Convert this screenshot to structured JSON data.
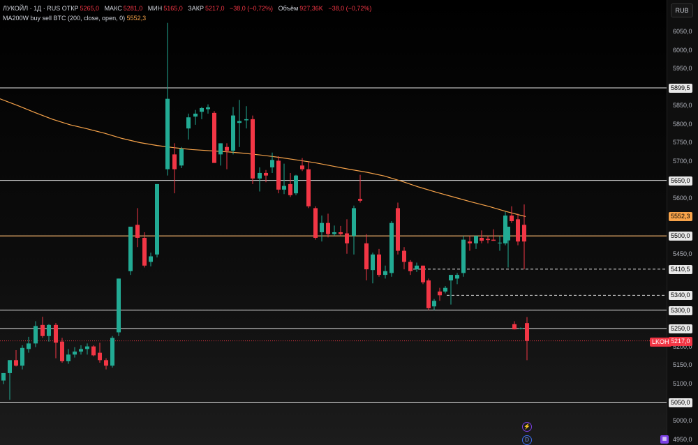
{
  "legend": {
    "title": "ЛУКОЙЛ · 1Д · RUS",
    "open_label": "ОТКР",
    "open_value": "5265,0",
    "high_label": "МАКС",
    "high_value": "5281,0",
    "low_label": "МИН",
    "low_value": "5165,0",
    "close_label": "ЗАКР",
    "close_value": "5217,0",
    "change_value": "−38,0 (−0,72%)",
    "volume_label": "Объём",
    "volume_value": "927,36K",
    "volume_change": "−38,0 (−0,72%)",
    "indicator": "MA200W buy sell BTC (200, close, open, 0)",
    "indicator_value": "5552,3"
  },
  "currency_button": "RUB",
  "ticker_tag": "LKOH",
  "price_axis": {
    "ticks": [
      "6050,0",
      "6000,0",
      "5950,0",
      "5850,0",
      "5800,0",
      "5750,0",
      "5700,0",
      "5600,0",
      "5450,0",
      "5250,0",
      "5200,0",
      "5150,0",
      "5100,0",
      "5000,0",
      "4950,0"
    ],
    "tick_values": [
      6050,
      6000,
      5950,
      5850,
      5800,
      5750,
      5700,
      5600,
      5450,
      5250,
      5200,
      5150,
      5100,
      5000,
      4950
    ]
  },
  "price_tags": [
    {
      "label": "5899,5",
      "value": 5899.5,
      "style": "white"
    },
    {
      "label": "5650,0",
      "value": 5650,
      "style": "white"
    },
    {
      "label": "5552,3",
      "value": 5552.3,
      "style": "orange"
    },
    {
      "label": "5500,0",
      "value": 5500,
      "style": "white"
    },
    {
      "label": "5410,5",
      "value": 5410.5,
      "style": "white"
    },
    {
      "label": "5340,0",
      "value": 5340,
      "style": "white"
    },
    {
      "label": "5300,0",
      "value": 5300,
      "style": "white"
    },
    {
      "label": "5250,0",
      "value": 5250,
      "style": "white"
    },
    {
      "label": "5217,0",
      "value": 5217,
      "style": "red"
    },
    {
      "label": "5050,0",
      "value": 5050,
      "style": "white"
    }
  ],
  "icons": {
    "lightning": "lightning-icon",
    "d_badge": "d-badge-icon",
    "logo": "tradingview-logo-icon"
  },
  "colors": {
    "up": "#22ab94",
    "down": "#f23645",
    "ma": "#f7a34a",
    "level": "#e8e8e8"
  },
  "chart_data": {
    "type": "candlestick",
    "title": "ЛУКОЙЛ · 1Д · RUS",
    "ylim": [
      4945,
      6075
    ],
    "grid": false,
    "horizontal_levels": [
      5899.5,
      5650,
      5500,
      5300,
      5250,
      5050
    ],
    "dashed_levels": [
      5410.5,
      5340
    ],
    "last_price": 5217,
    "ma_series": {
      "name": "MA200W buy sell BTC",
      "points": [
        [
          0,
          5870
        ],
        [
          25,
          5852
        ],
        [
          50,
          5833
        ],
        [
          75,
          5815
        ],
        [
          100,
          5800
        ],
        [
          125,
          5789
        ],
        [
          150,
          5777
        ],
        [
          175,
          5763
        ],
        [
          200,
          5752
        ],
        [
          225,
          5744
        ],
        [
          250,
          5738
        ],
        [
          275,
          5733
        ],
        [
          300,
          5730
        ],
        [
          325,
          5727
        ],
        [
          350,
          5723
        ],
        [
          375,
          5718
        ],
        [
          400,
          5712
        ],
        [
          425,
          5705
        ],
        [
          450,
          5698
        ],
        [
          475,
          5689
        ],
        [
          500,
          5680
        ],
        [
          525,
          5672
        ],
        [
          550,
          5662
        ],
        [
          575,
          5648
        ],
        [
          600,
          5632
        ],
        [
          625,
          5618
        ],
        [
          650,
          5605
        ],
        [
          675,
          5592
        ],
        [
          700,
          5580
        ],
        [
          725,
          5566
        ],
        [
          753,
          5552.3
        ]
      ]
    },
    "candles": [
      {
        "i": 0,
        "o": 5110,
        "h": 5125,
        "l": 5100,
        "c": 5130
      },
      {
        "i": 1,
        "o": 5130,
        "h": 5165,
        "l": 5058,
        "c": 5165
      },
      {
        "i": 2,
        "o": 5165,
        "h": 5192,
        "l": 5148,
        "c": 5150
      },
      {
        "i": 3,
        "o": 5150,
        "h": 5205,
        "l": 5140,
        "c": 5198
      },
      {
        "i": 4,
        "o": 5195,
        "h": 5228,
        "l": 5185,
        "c": 5210
      },
      {
        "i": 5,
        "o": 5210,
        "h": 5270,
        "l": 5200,
        "c": 5257
      },
      {
        "i": 6,
        "o": 5260,
        "h": 5282,
        "l": 5225,
        "c": 5230
      },
      {
        "i": 7,
        "o": 5230,
        "h": 5262,
        "l": 5215,
        "c": 5260
      },
      {
        "i": 8,
        "o": 5260,
        "h": 5265,
        "l": 5170,
        "c": 5212
      },
      {
        "i": 9,
        "o": 5215,
        "h": 5225,
        "l": 5158,
        "c": 5162
      },
      {
        "i": 10,
        "o": 5162,
        "h": 5195,
        "l": 5155,
        "c": 5180
      },
      {
        "i": 11,
        "o": 5180,
        "h": 5200,
        "l": 5172,
        "c": 5188
      },
      {
        "i": 12,
        "o": 5188,
        "h": 5205,
        "l": 5180,
        "c": 5195
      },
      {
        "i": 13,
        "o": 5195,
        "h": 5210,
        "l": 5180,
        "c": 5202
      },
      {
        "i": 14,
        "o": 5202,
        "h": 5205,
        "l": 5175,
        "c": 5178
      },
      {
        "i": 15,
        "o": 5185,
        "h": 5212,
        "l": 5158,
        "c": 5165
      },
      {
        "i": 16,
        "o": 5165,
        "h": 5170,
        "l": 5140,
        "c": 5150
      },
      {
        "i": 17,
        "o": 5150,
        "h": 5230,
        "l": 5145,
        "c": 5225
      },
      {
        "i": 18,
        "o": 5240,
        "h": 5385,
        "l": 5230,
        "c": 5385
      },
      {
        "i": 19,
        "o": 5405,
        "h": 5525,
        "l": 5395,
        "c": 5525
      },
      {
        "i": 20,
        "o": 5530,
        "h": 5575,
        "l": 5470,
        "c": 5495
      },
      {
        "i": 21,
        "o": 5495,
        "h": 5510,
        "l": 5415,
        "c": 5420
      },
      {
        "i": 22,
        "o": 5430,
        "h": 5455,
        "l": 5418,
        "c": 5445
      },
      {
        "i": 23,
        "o": 5450,
        "h": 5640,
        "l": 5442,
        "c": 5640
      },
      {
        "i": 24,
        "o": 5680,
        "h": 6075,
        "l": 5663,
        "c": 5870
      },
      {
        "i": 25,
        "o": 5720,
        "h": 5750,
        "l": 5615,
        "c": 5680
      },
      {
        "i": 26,
        "o": 5690,
        "h": 5740,
        "l": 5683,
        "c": 5735
      },
      {
        "i": 27,
        "o": 5790,
        "h": 5830,
        "l": 5760,
        "c": 5820
      },
      {
        "i": 28,
        "o": 5822,
        "h": 5840,
        "l": 5800,
        "c": 5830
      },
      {
        "i": 29,
        "o": 5835,
        "h": 5848,
        "l": 5815,
        "c": 5845
      },
      {
        "i": 30,
        "o": 5842,
        "h": 5855,
        "l": 5830,
        "c": 5847
      },
      {
        "i": 31,
        "o": 5832,
        "h": 5837,
        "l": 5697,
        "c": 5697
      },
      {
        "i": 32,
        "o": 5720,
        "h": 5750,
        "l": 5690,
        "c": 5750
      },
      {
        "i": 33,
        "o": 5740,
        "h": 5750,
        "l": 5680,
        "c": 5730
      },
      {
        "i": 34,
        "o": 5730,
        "h": 5848,
        "l": 5720,
        "c": 5825
      },
      {
        "i": 35,
        "o": 5805,
        "h": 5867,
        "l": 5740,
        "c": 5810
      },
      {
        "i": 36,
        "o": 5812,
        "h": 5850,
        "l": 5790,
        "c": 5815
      },
      {
        "i": 37,
        "o": 5815,
        "h": 5825,
        "l": 5640,
        "c": 5655
      },
      {
        "i": 38,
        "o": 5655,
        "h": 5685,
        "l": 5620,
        "c": 5670
      },
      {
        "i": 39,
        "o": 5670,
        "h": 5678,
        "l": 5645,
        "c": 5663
      },
      {
        "i": 40,
        "o": 5685,
        "h": 5725,
        "l": 5670,
        "c": 5705
      },
      {
        "i": 41,
        "o": 5703,
        "h": 5715,
        "l": 5615,
        "c": 5625
      },
      {
        "i": 42,
        "o": 5625,
        "h": 5695,
        "l": 5613,
        "c": 5635
      },
      {
        "i": 43,
        "o": 5640,
        "h": 5670,
        "l": 5605,
        "c": 5610
      },
      {
        "i": 44,
        "o": 5615,
        "h": 5665,
        "l": 5610,
        "c": 5663
      },
      {
        "i": 45,
        "o": 5690,
        "h": 5710,
        "l": 5675,
        "c": 5680
      },
      {
        "i": 46,
        "o": 5680,
        "h": 5700,
        "l": 5575,
        "c": 5580
      },
      {
        "i": 47,
        "o": 5575,
        "h": 5580,
        "l": 5490,
        "c": 5495
      },
      {
        "i": 48,
        "o": 5510,
        "h": 5555,
        "l": 5485,
        "c": 5535
      },
      {
        "i": 49,
        "o": 5535,
        "h": 5560,
        "l": 5496,
        "c": 5505
      },
      {
        "i": 50,
        "o": 5505,
        "h": 5528,
        "l": 5500,
        "c": 5510
      },
      {
        "i": 51,
        "o": 5510,
        "h": 5527,
        "l": 5500,
        "c": 5505
      },
      {
        "i": 52,
        "o": 5507,
        "h": 5545,
        "l": 5452,
        "c": 5480
      },
      {
        "i": 53,
        "o": 5500,
        "h": 5582,
        "l": 5450,
        "c": 5575
      },
      {
        "i": 54,
        "o": 5600,
        "h": 5665,
        "l": 5590,
        "c": 5595
      },
      {
        "i": 55,
        "o": 5480,
        "h": 5505,
        "l": 5380,
        "c": 5410
      },
      {
        "i": 56,
        "o": 5408,
        "h": 5455,
        "l": 5372,
        "c": 5450
      },
      {
        "i": 57,
        "o": 5450,
        "h": 5465,
        "l": 5390,
        "c": 5395
      },
      {
        "i": 58,
        "o": 5395,
        "h": 5420,
        "l": 5385,
        "c": 5405
      },
      {
        "i": 59,
        "o": 5400,
        "h": 5540,
        "l": 5390,
        "c": 5535
      },
      {
        "i": 60,
        "o": 5575,
        "h": 5590,
        "l": 5450,
        "c": 5460
      },
      {
        "i": 61,
        "o": 5460,
        "h": 5470,
        "l": 5410,
        "c": 5430
      },
      {
        "i": 62,
        "o": 5430,
        "h": 5435,
        "l": 5395,
        "c": 5405
      },
      {
        "i": 63,
        "o": 5410,
        "h": 5428,
        "l": 5403,
        "c": 5420
      },
      {
        "i": 64,
        "o": 5420,
        "h": 5410,
        "l": 5370,
        "c": 5375
      },
      {
        "i": 65,
        "o": 5380,
        "h": 5385,
        "l": 5300,
        "c": 5305
      },
      {
        "i": 66,
        "o": 5310,
        "h": 5330,
        "l": 5300,
        "c": 5325
      },
      {
        "i": 67,
        "o": 5350,
        "h": 5360,
        "l": 5325,
        "c": 5340
      },
      {
        "i": 68,
        "o": 5350,
        "h": 5365,
        "l": 5345,
        "c": 5360
      },
      {
        "i": 69,
        "o": 5380,
        "h": 5395,
        "l": 5315,
        "c": 5395
      },
      {
        "i": 70,
        "o": 5385,
        "h": 5400,
        "l": 5370,
        "c": 5395
      },
      {
        "i": 71,
        "o": 5400,
        "h": 5500,
        "l": 5390,
        "c": 5490
      },
      {
        "i": 72,
        "o": 5485,
        "h": 5500,
        "l": 5460,
        "c": 5480
      },
      {
        "i": 73,
        "o": 5480,
        "h": 5500,
        "l": 5465,
        "c": 5500
      },
      {
        "i": 74,
        "o": 5495,
        "h": 5515,
        "l": 5480,
        "c": 5487
      },
      {
        "i": 75,
        "o": 5492,
        "h": 5500,
        "l": 5480,
        "c": 5489
      },
      {
        "i": 76,
        "o": 5490,
        "h": 5518,
        "l": 5487,
        "c": 5487
      },
      {
        "i": 77,
        "o": 5480,
        "h": 5500,
        "l": 5460,
        "c": 5482
      },
      {
        "i": 78,
        "o": 5480,
        "h": 5565,
        "l": 5475,
        "c": 5555
      },
      {
        "i": 79,
        "o": 5555,
        "h": 5580,
        "l": 5535,
        "c": 5540
      },
      {
        "i": 80,
        "o": 5545,
        "h": 5560,
        "l": 5475,
        "c": 5485
      },
      {
        "i": 81,
        "o": 5530,
        "h": 5585,
        "l": 5410,
        "c": 5485
      },
      {
        "i": 82,
        "o": 5488,
        "h": 5525,
        "l": 5415,
        "c": 5525
      },
      {
        "i": 83,
        "o": 5262,
        "h": 5270,
        "l": 5248,
        "c": 5248
      },
      {
        "i": 84,
        "o": 5250,
        "h": 5253,
        "l": 5248,
        "c": 5251
      },
      {
        "i": 85,
        "o": 5250,
        "h": 5263,
        "l": 5248,
        "c": 5260
      },
      {
        "i": 86,
        "o": 5265,
        "h": 5281,
        "l": 5165,
        "c": 5217
      }
    ],
    "candle_x": [
      5,
      14,
      23,
      32,
      41,
      51,
      61,
      70,
      80,
      89,
      98,
      107,
      116,
      125,
      134,
      143,
      152,
      161,
      170,
      187,
      197,
      207,
      216,
      225,
      240,
      250,
      260,
      270,
      280,
      289,
      298,
      307,
      316,
      325,
      334,
      343,
      353,
      362,
      372,
      381,
      390,
      399,
      407,
      416,
      424,
      433,
      442,
      452,
      461,
      470,
      479,
      488,
      497,
      507,
      516,
      525,
      534,
      543,
      552,
      561,
      570,
      579,
      588,
      597,
      606,
      614,
      622,
      630,
      638,
      646,
      655,
      664,
      673,
      682,
      690,
      699,
      707,
      716,
      724,
      733,
      742,
      751,
      728,
      737,
      746,
      755,
      755
    ]
  }
}
